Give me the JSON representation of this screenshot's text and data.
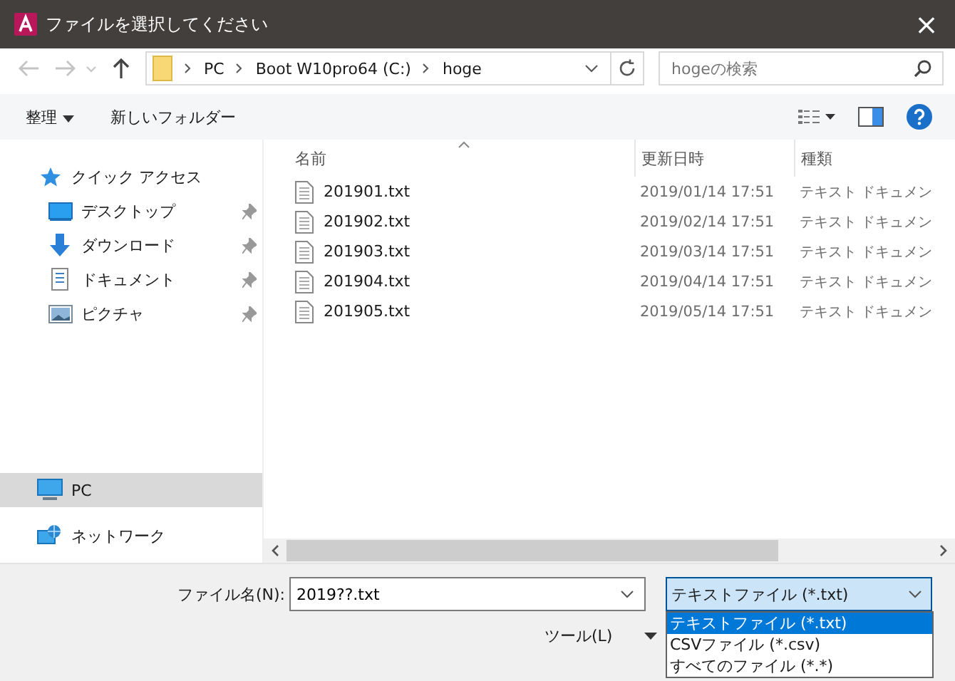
{
  "window": {
    "title": "ファイルを選択してください",
    "close": "×"
  },
  "address": {
    "path": [
      "PC",
      "Boot W10pro64 (C:)",
      "hoge"
    ]
  },
  "search": {
    "placeholder": "hogeの検索"
  },
  "toolbar": {
    "organize": "整理",
    "new_folder": "新しいフォルダー"
  },
  "sidebar": {
    "items": [
      {
        "label": "クイック アクセス",
        "kind": "star",
        "selected": false,
        "children": [
          {
            "label": "デスクトップ",
            "kind": "desktop",
            "pinned": true,
            "selected": false
          },
          {
            "label": "ダウンロード",
            "kind": "download",
            "pinned": true,
            "selected": false
          },
          {
            "label": "ドキュメント",
            "kind": "document",
            "pinned": true,
            "selected": false
          },
          {
            "label": "ピクチャ",
            "kind": "picture",
            "pinned": true,
            "selected": false
          }
        ]
      },
      {
        "label": "PC",
        "kind": "pc",
        "selected": true
      },
      {
        "label": "ネットワーク",
        "kind": "network",
        "selected": false
      }
    ]
  },
  "table": {
    "columns": [
      "名前",
      "更新日時",
      "種類"
    ],
    "rows": [
      {
        "name": "201901.txt",
        "modified": "2019/01/14 17:51",
        "type": "テキスト ドキュメン"
      },
      {
        "name": "201902.txt",
        "modified": "2019/02/14 17:51",
        "type": "テキスト ドキュメン"
      },
      {
        "name": "201903.txt",
        "modified": "2019/03/14 17:51",
        "type": "テキスト ドキュメン"
      },
      {
        "name": "201904.txt",
        "modified": "2019/04/14 17:51",
        "type": "テキスト ドキュメン"
      },
      {
        "name": "201905.txt",
        "modified": "2019/05/14 17:51",
        "type": "テキスト ドキュメン"
      }
    ]
  },
  "filename": {
    "label": "ファイル名(N):",
    "value": "2019??.txt"
  },
  "filetype": {
    "value": "テキストファイル (*.txt)",
    "expanded": true,
    "options": [
      {
        "label": "テキストファイル (*.txt)",
        "selected": true
      },
      {
        "label": "CSVファイル (*.csv)",
        "selected": false
      },
      {
        "label": "すべてのファイル (*.*)",
        "selected": false
      }
    ]
  },
  "tools": {
    "label": "ツール(L)"
  }
}
